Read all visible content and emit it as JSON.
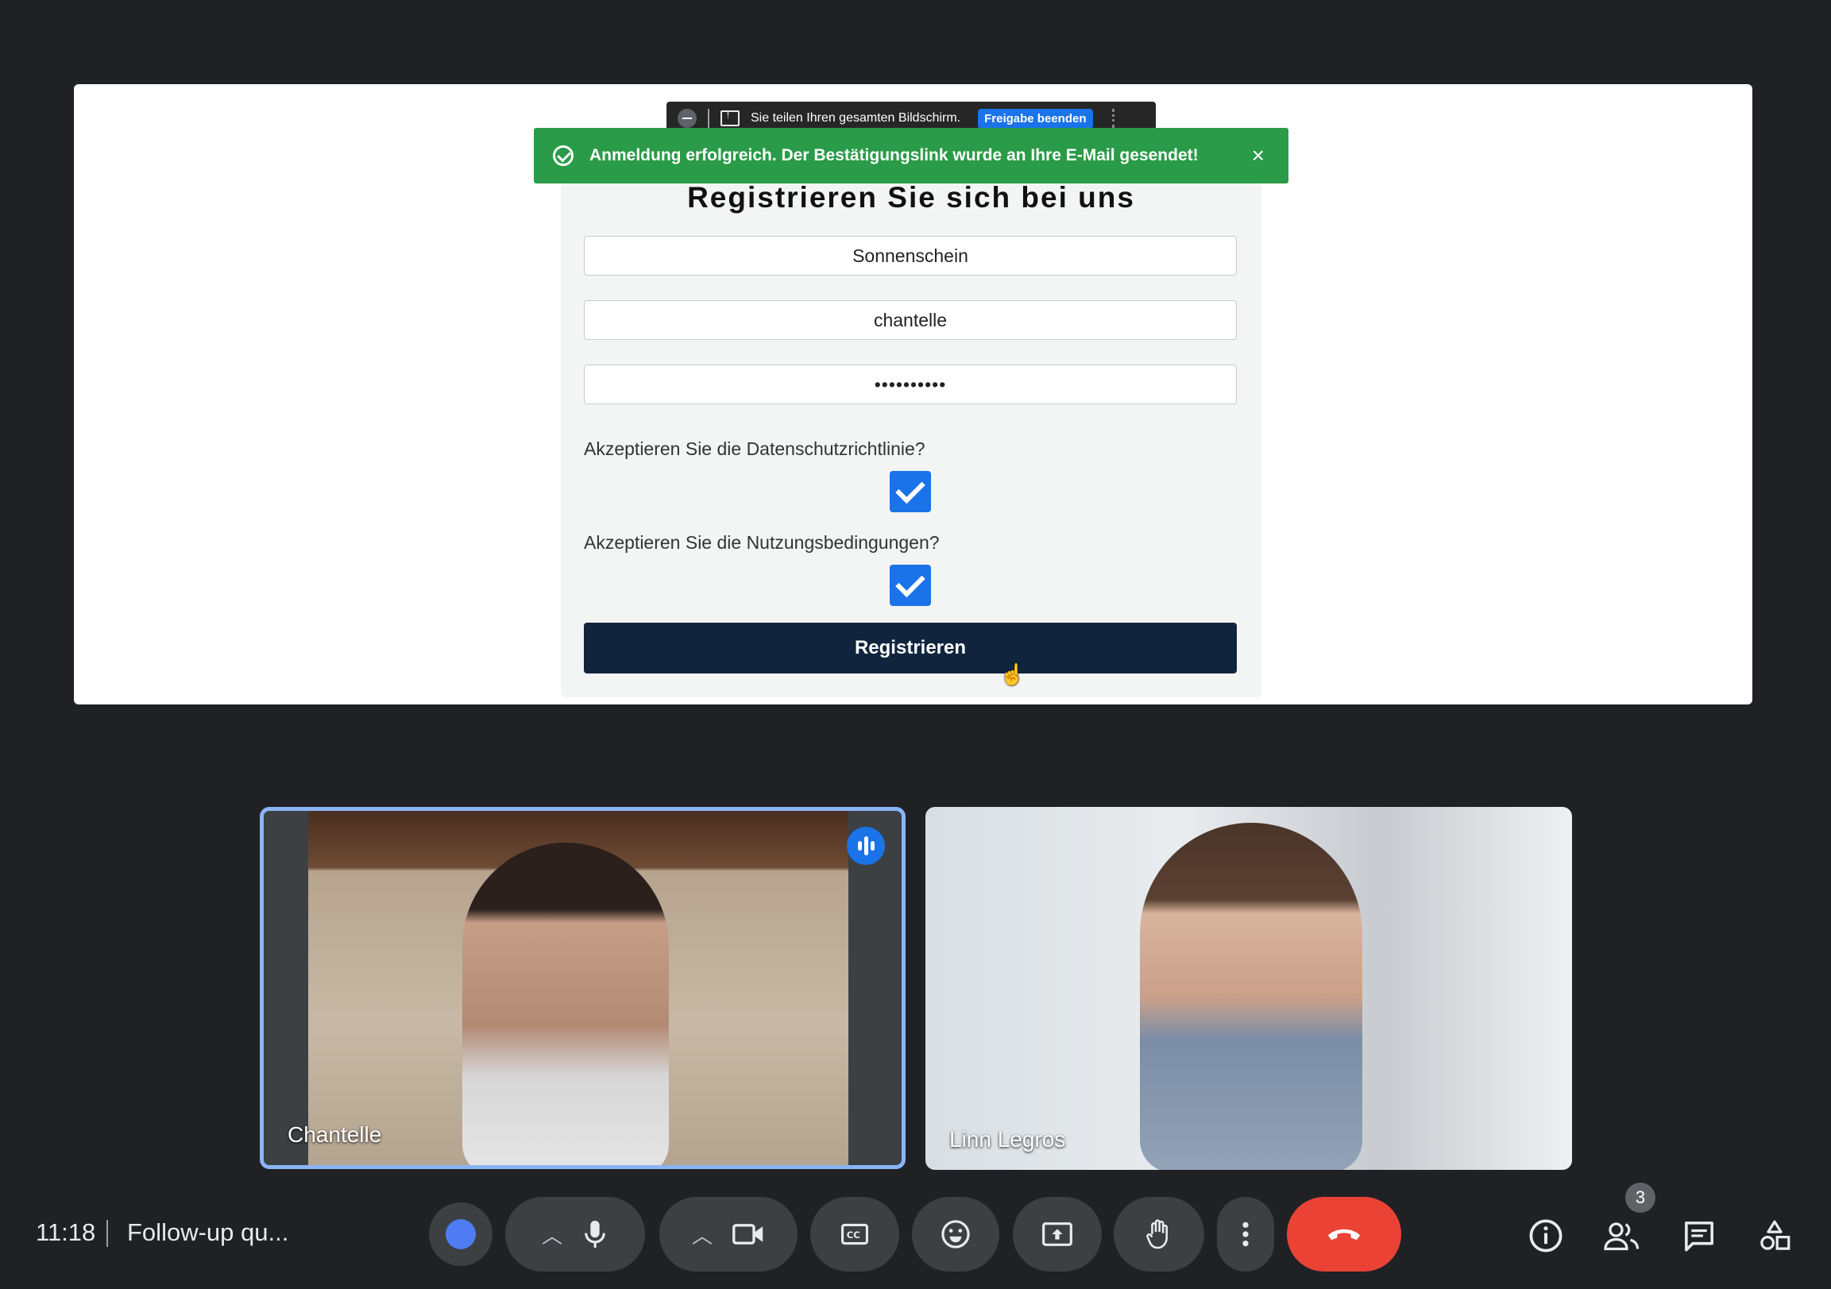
{
  "share_bar": {
    "message": "Sie teilen Ihren gesamten Bildschirm.",
    "stop_label": "Freigabe beenden"
  },
  "toast": {
    "message": "Anmeldung erfolgreich. Der Bestätigungslink wurde an Ihre E-Mail gesendet!",
    "close_symbol": "×"
  },
  "form": {
    "title": "Registrieren Sie sich bei uns",
    "field1_value": "Sonnenschein",
    "field2_value": "chantelle",
    "password_value": "••••••••••",
    "privacy_question": "Akzeptieren Sie die Datenschutzrichtlinie?",
    "privacy_checked": true,
    "terms_question": "Akzeptieren Sie die Nutzungsbedingungen?",
    "terms_checked": true,
    "submit_label": "Registrieren"
  },
  "participants": [
    {
      "name": "Chantelle",
      "speaking": true
    },
    {
      "name": "Linn Legros",
      "speaking": false
    }
  ],
  "bottom_bar": {
    "time": "11:18",
    "meeting_title": "Follow-up qu...",
    "participant_count": "3",
    "colors": {
      "leave": "#ea4335",
      "accent": "#1a73e8",
      "reaction_dot": "#4f7cf2"
    }
  }
}
